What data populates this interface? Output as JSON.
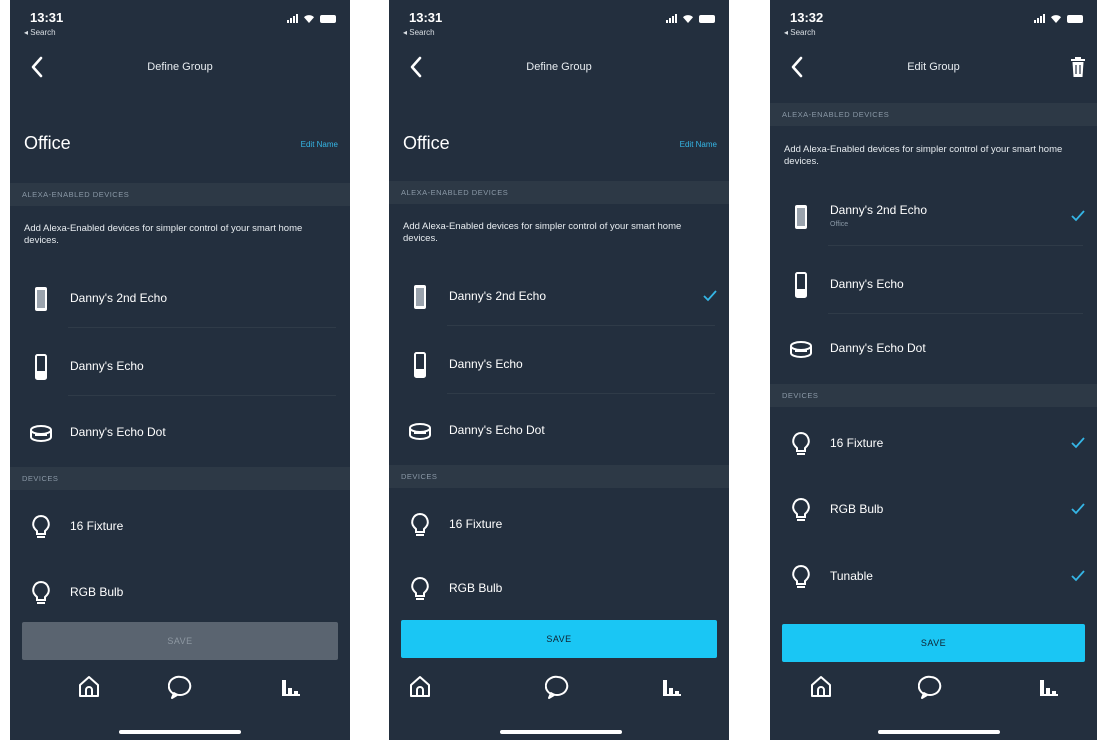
{
  "colors": {
    "background": "#232f3e",
    "accent": "#35b6e6",
    "save_enabled": "#1ac6f4",
    "save_disabled": "#5a6470",
    "section_bg": "#2d3946"
  },
  "screens": [
    {
      "status_time": "13:31",
      "status_back": "◂ Search",
      "nav_title": "Define Group",
      "group_name": "Office",
      "edit_name_label": "Edit Name",
      "alexa_section": "ALEXA-ENABLED DEVICES",
      "alexa_description": "Add Alexa-Enabled devices for simpler control of your smart home devices.",
      "alexa_devices": [
        {
          "label": "Danny's 2nd Echo",
          "icon": "echo-tall-icon",
          "checked": false
        },
        {
          "label": "Danny's Echo",
          "icon": "echo-icon",
          "checked": false
        },
        {
          "label": "Danny's Echo Dot",
          "icon": "echo-dot-icon",
          "checked": false
        }
      ],
      "devices_section": "DEVICES",
      "devices": [
        {
          "label": "16 Fixture",
          "icon": "bulb-icon",
          "checked": false
        },
        {
          "label": "RGB Bulb",
          "icon": "bulb-icon",
          "checked": false
        }
      ],
      "save_label": "SAVE",
      "save_state": "disabled"
    },
    {
      "status_time": "13:31",
      "status_back": "◂ Search",
      "nav_title": "Define Group",
      "group_name": "Office",
      "edit_name_label": "Edit Name",
      "alexa_section": "ALEXA-ENABLED DEVICES",
      "alexa_description": "Add Alexa-Enabled devices for simpler control of your smart home devices.",
      "alexa_devices": [
        {
          "label": "Danny's 2nd Echo",
          "icon": "echo-tall-icon",
          "checked": true
        },
        {
          "label": "Danny's Echo",
          "icon": "echo-icon",
          "checked": false
        },
        {
          "label": "Danny's Echo Dot",
          "icon": "echo-dot-icon",
          "checked": false
        }
      ],
      "devices_section": "DEVICES",
      "devices": [
        {
          "label": "16 Fixture",
          "icon": "bulb-icon",
          "checked": false
        },
        {
          "label": "RGB Bulb",
          "icon": "bulb-icon",
          "checked": false
        }
      ],
      "save_label": "SAVE",
      "save_state": "enabled"
    },
    {
      "status_time": "13:32",
      "status_back": "◂ Search",
      "nav_title": "Edit Group",
      "alexa_section": "ALEXA-ENABLED DEVICES",
      "alexa_description": "Add Alexa-Enabled devices for simpler control of your smart home devices.",
      "alexa_devices": [
        {
          "label": "Danny's 2nd Echo",
          "sublabel": "Office",
          "icon": "echo-tall-icon",
          "checked": true
        },
        {
          "label": "Danny's Echo",
          "icon": "echo-icon",
          "checked": false
        },
        {
          "label": "Danny's Echo Dot",
          "icon": "echo-dot-icon",
          "checked": false
        }
      ],
      "devices_section": "DEVICES",
      "devices": [
        {
          "label": "16 Fixture",
          "icon": "bulb-icon",
          "checked": true
        },
        {
          "label": "RGB Bulb",
          "icon": "bulb-icon",
          "checked": true
        },
        {
          "label": "Tunable",
          "icon": "bulb-icon",
          "checked": true
        }
      ],
      "save_label": "SAVE",
      "save_state": "enabled"
    }
  ],
  "tabs": [
    {
      "icon": "home-icon"
    },
    {
      "icon": "chat-icon"
    },
    {
      "icon": "devices-icon"
    }
  ]
}
